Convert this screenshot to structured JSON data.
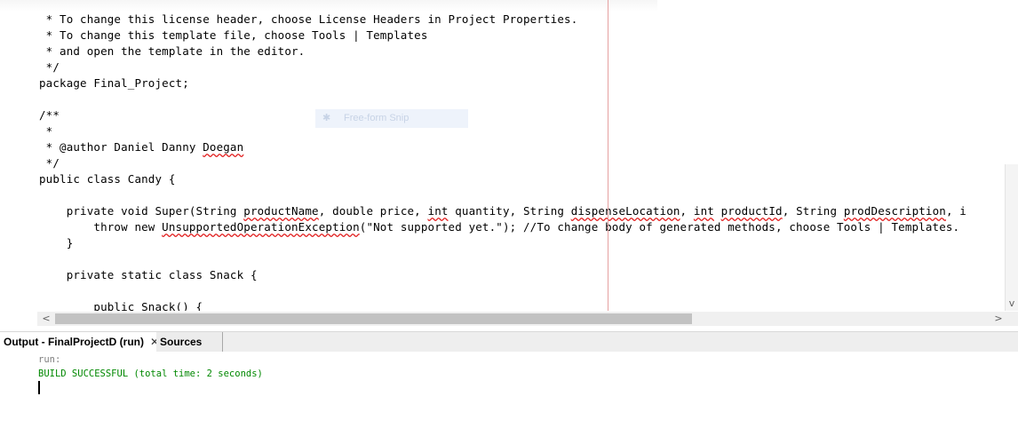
{
  "editor": {
    "lines": [
      [
        {
          "t": " * To change this license header, choose License Headers in Project Properties."
        }
      ],
      [
        {
          "t": " * To change this template file, choose Tools | Templates"
        }
      ],
      [
        {
          "t": " * and open the template in the editor."
        }
      ],
      [
        {
          "t": " */"
        }
      ],
      [
        {
          "t": "package Final_Project;"
        }
      ],
      [],
      [
        {
          "t": "/**"
        }
      ],
      [
        {
          "t": " *"
        }
      ],
      [
        {
          "t": " * @author Daniel Danny "
        },
        {
          "t": "Doegan",
          "sq": true
        }
      ],
      [
        {
          "t": " */"
        }
      ],
      [
        {
          "t": "public class Candy {"
        }
      ],
      [],
      [
        {
          "t": "    private void Super(String "
        },
        {
          "t": "productName",
          "sq": true
        },
        {
          "t": ", double price, "
        },
        {
          "t": "int",
          "sq": true
        },
        {
          "t": " quantity, String "
        },
        {
          "t": "dispenseLocation",
          "sq": true
        },
        {
          "t": ", "
        },
        {
          "t": "int",
          "sq": true
        },
        {
          "t": " "
        },
        {
          "t": "productId",
          "sq": true
        },
        {
          "t": ", String "
        },
        {
          "t": "prodDescription",
          "sq": true
        },
        {
          "t": ", i"
        }
      ],
      [
        {
          "t": "        throw new "
        },
        {
          "t": "UnsupportedOperationException",
          "sq": true
        },
        {
          "t": "(\"Not supported yet.\"); //To change body of generated methods, choose Tools | Templates."
        }
      ],
      [
        {
          "t": "    }"
        }
      ],
      [],
      [
        {
          "t": "    private static class Snack {"
        }
      ],
      [],
      [
        {
          "t": "        public Snack() {"
        }
      ]
    ]
  },
  "ghost": {
    "label": "Free-form Snip",
    "icon": "scissors-icon"
  },
  "scroll": {
    "left_arrow": "<",
    "right_arrow": ">",
    "down_arrow": "v"
  },
  "tabs": {
    "output_label": "Output - FinalProjectD (run)",
    "close_glyph": "✕",
    "sources_label": "Sources"
  },
  "output": {
    "run_label": "run:",
    "build_message": "BUILD SUCCESSFUL (total time: 2 seconds)",
    "run_color": "#808080",
    "build_color": "#008800"
  }
}
